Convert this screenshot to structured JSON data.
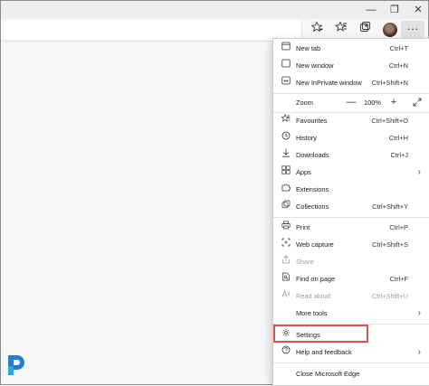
{
  "menu": {
    "new_tab": {
      "label": "New tab",
      "shortcut": "Ctrl+T"
    },
    "new_window": {
      "label": "New window",
      "shortcut": "Ctrl+N"
    },
    "new_inprivate": {
      "label": "New InPrivate window",
      "shortcut": "Ctrl+Shift+N"
    },
    "zoom": {
      "label": "Zoom",
      "minus": "—",
      "value": "100%",
      "plus": "+"
    },
    "favourites": {
      "label": "Favourites",
      "shortcut": "Ctrl+Shift+O"
    },
    "history": {
      "label": "History",
      "shortcut": "Ctrl+H"
    },
    "downloads": {
      "label": "Downloads",
      "shortcut": "Ctrl+J"
    },
    "apps": {
      "label": "Apps"
    },
    "extensions": {
      "label": "Extensions"
    },
    "collections": {
      "label": "Collections",
      "shortcut": "Ctrl+Shift+Y"
    },
    "print": {
      "label": "Print",
      "shortcut": "Ctrl+P"
    },
    "web_capture": {
      "label": "Web capture",
      "shortcut": "Ctrl+Shift+S"
    },
    "share": {
      "label": "Share"
    },
    "find_on_page": {
      "label": "Find on page",
      "shortcut": "Ctrl+F"
    },
    "read_aloud": {
      "label": "Read aloud",
      "shortcut": "Ctrl+Shift+U"
    },
    "more_tools": {
      "label": "More tools"
    },
    "settings": {
      "label": "Settings"
    },
    "help_feedback": {
      "label": "Help and feedback"
    },
    "close_edge": {
      "label": "Close Microsoft Edge"
    }
  },
  "colors": {
    "highlight_border": "#d9534f",
    "menu_bg": "#ffffff",
    "disabled_text": "#a0a0a0"
  }
}
